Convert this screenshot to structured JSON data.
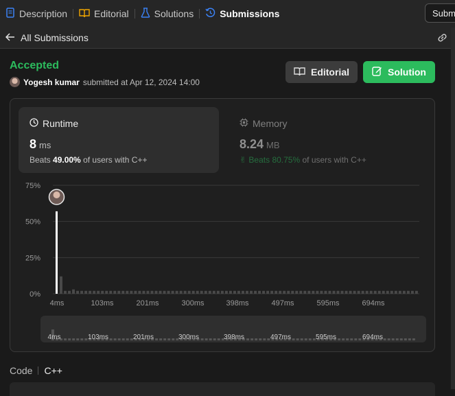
{
  "tabs": [
    {
      "label": "Description",
      "icon": "document-icon",
      "color": "#3b82f6"
    },
    {
      "label": "Editorial",
      "icon": "book-icon",
      "color": "#f0a500"
    },
    {
      "label": "Solutions",
      "icon": "flask-icon",
      "color": "#3b82f6"
    },
    {
      "label": "Submissions",
      "icon": "history-icon",
      "color": "#3b82f6",
      "active": true
    }
  ],
  "tooltip": "Submi",
  "subheader": {
    "back_label": "All Submissions"
  },
  "submission": {
    "status": "Accepted",
    "author": "Yogesh kumar",
    "submitted_text": "submitted at Apr 12, 2024 14:00"
  },
  "buttons": {
    "editorial": "Editorial",
    "solution": "Solution"
  },
  "runtime": {
    "title": "Runtime",
    "value": "8",
    "unit": "ms",
    "beats_label": "Beats",
    "beats_pct": "49.00%",
    "beats_suffix": "of users with C++"
  },
  "memory": {
    "title": "Memory",
    "value": "8.24",
    "unit": "MB",
    "beats_label": "Beats",
    "beats_pct": "80.75%",
    "beats_suffix": "of users with C++"
  },
  "code": {
    "label": "Code",
    "language": "C++"
  },
  "colors": {
    "accent_green": "#2cbb5d",
    "bar": "#4a4a4a",
    "highlight_bar": "#ffffff"
  },
  "chart_data": {
    "type": "bar",
    "title": "",
    "y_ticks": [
      "75%",
      "50%",
      "25%",
      "0%"
    ],
    "ylim": [
      0,
      75
    ],
    "x_ticks": [
      "4ms",
      "103ms",
      "201ms",
      "300ms",
      "398ms",
      "497ms",
      "595ms",
      "694ms"
    ],
    "values": [
      57,
      12,
      2,
      2,
      3,
      2,
      2,
      2,
      2,
      2,
      2,
      2,
      2,
      2,
      2,
      2,
      2,
      2,
      2,
      2,
      2,
      2,
      2,
      2,
      2,
      2,
      2,
      2,
      2,
      2,
      2,
      2,
      2,
      2,
      2,
      2,
      2,
      2,
      2,
      2,
      2,
      2,
      2,
      2,
      2,
      2,
      2,
      2,
      2,
      2,
      2,
      2,
      2,
      2,
      2,
      2,
      2,
      2,
      2,
      2,
      2,
      2,
      2,
      2,
      2,
      2,
      2,
      2,
      2,
      2,
      2,
      2,
      2,
      2,
      2,
      2,
      2,
      2,
      2,
      2,
      2,
      2,
      2,
      2,
      2,
      2,
      2,
      2
    ],
    "highlight_index": 0,
    "grid": true
  }
}
